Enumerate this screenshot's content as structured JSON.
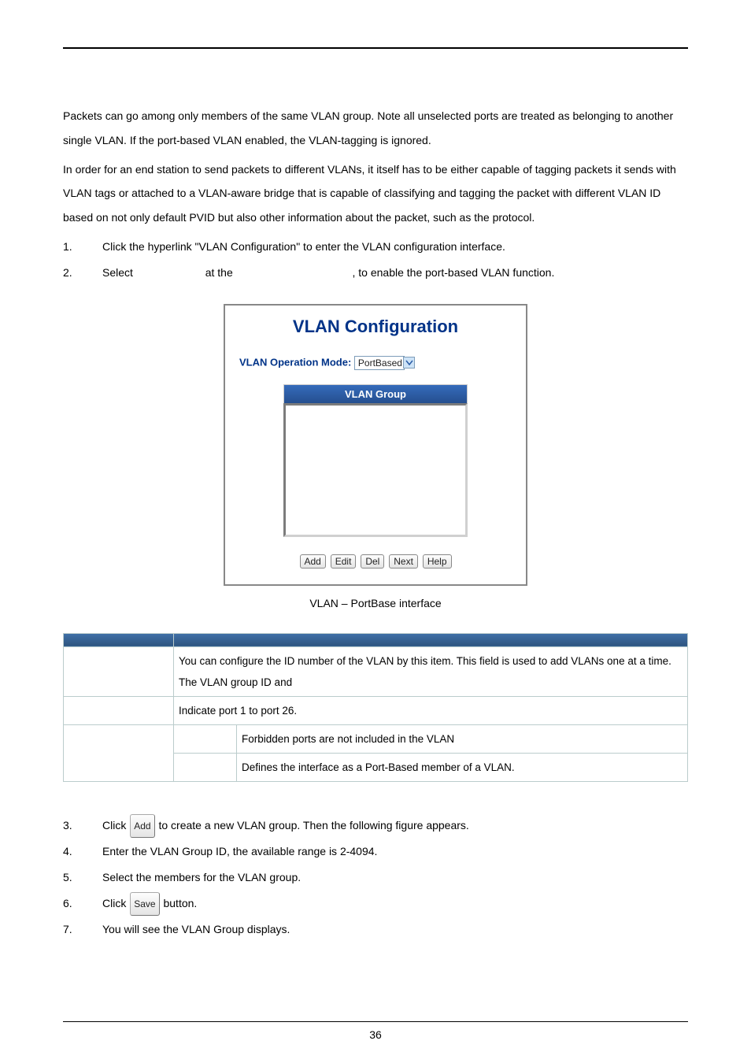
{
  "intro": {
    "p1": "Packets can go among only members of the same VLAN group. Note all unselected ports are treated as belonging to another single VLAN. If the port-based VLAN enabled, the VLAN-tagging is ignored.",
    "p2": "In order for an end station to send packets to different VLANs, it itself has to be either capable of tagging packets it sends with VLAN tags or attached to a VLAN-aware bridge that is capable of classifying and tagging the packet with different VLAN ID based on not only default PVID but also other information about the packet, such as the protocol."
  },
  "steps_a": {
    "n1": "1.",
    "t1": "Click the hyperlink \"VLAN Configuration\" to enter the VLAN configuration interface.",
    "n2": "2.",
    "t2_a": "Select",
    "t2_b": "at the",
    "t2_c": ", to enable the port-based VLAN function."
  },
  "figure": {
    "title": "VLAN Configuration",
    "mode_label": "VLAN Operation Mode:",
    "mode_value": "PortBased",
    "group_header": "VLAN Group",
    "buttons": {
      "add": "Add",
      "edit": "Edit",
      "del": "Del",
      "next": "Next",
      "help": "Help"
    },
    "caption": "VLAN – PortBase interface"
  },
  "table": {
    "headers": {
      "object": "",
      "description": ""
    },
    "rows": {
      "r1": {
        "c1": "",
        "c2": "You can configure the ID number of the VLAN by this item. This field is used to add VLANs one at a time. The VLAN group ID and"
      },
      "r2": {
        "c1": "",
        "c2": "Indicate port 1 to port 26."
      },
      "r3": {
        "c1": "",
        "c2a": "",
        "c2b": "Forbidden ports are not included in the VLAN"
      },
      "r4": {
        "c2a": "",
        "c2b": "Defines the interface as a Port-Based member of a VLAN."
      }
    }
  },
  "steps_b": {
    "n3": "3.",
    "t3_a": "Click ",
    "t3_btn": "Add",
    "t3_b": " to create a new VLAN group. Then the following figure appears.",
    "n4": "4.",
    "t4": "Enter the VLAN Group ID, the available range is 2-4094.",
    "n5": "5.",
    "t5": "Select the members for the VLAN group.",
    "n6": "6.",
    "t6_a": "Click ",
    "t6_btn": "Save",
    "t6_b": " button.",
    "n7": "7.",
    "t7": "You will see the VLAN Group displays."
  },
  "page_number": "36"
}
